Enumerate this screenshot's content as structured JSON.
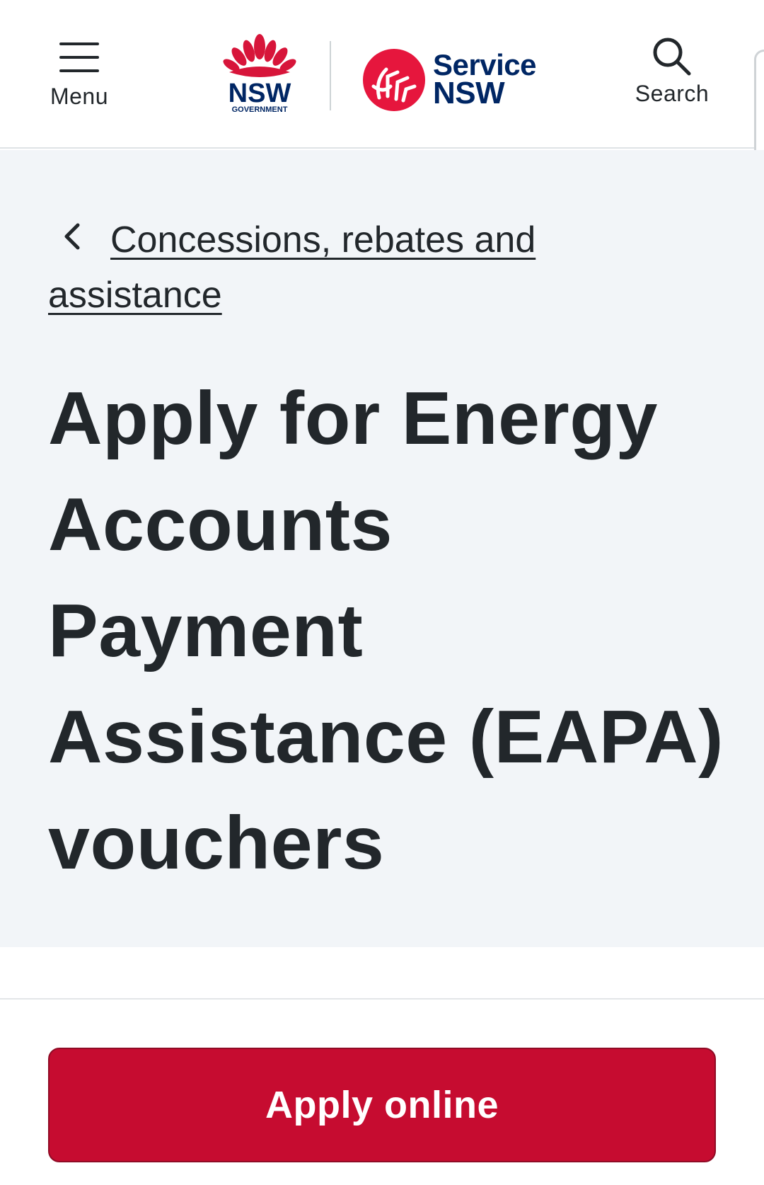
{
  "header": {
    "menu_label": "Menu",
    "search_label": "Search",
    "nsw_logo_text": "NSW",
    "nsw_logo_subtext": "GOVERNMENT",
    "service_logo_line1": "Service",
    "service_logo_line2": "NSW"
  },
  "breadcrumb": {
    "label": "Concessions, rebates and assistance"
  },
  "page": {
    "title": "Apply for Energy Accounts Payment Assistance (EAPA) vouchers"
  },
  "actions": {
    "apply_label": "Apply online"
  },
  "colors": {
    "brand_red": "#c60c30",
    "brand_navy": "#002664",
    "hero_bg": "#f2f5f8",
    "text": "#22272b"
  },
  "icons": {
    "menu": "hamburger-icon",
    "search": "magnifier-icon",
    "back": "chevron-left-icon",
    "nsw": "waratah-logo",
    "service": "service-nsw-logo"
  }
}
